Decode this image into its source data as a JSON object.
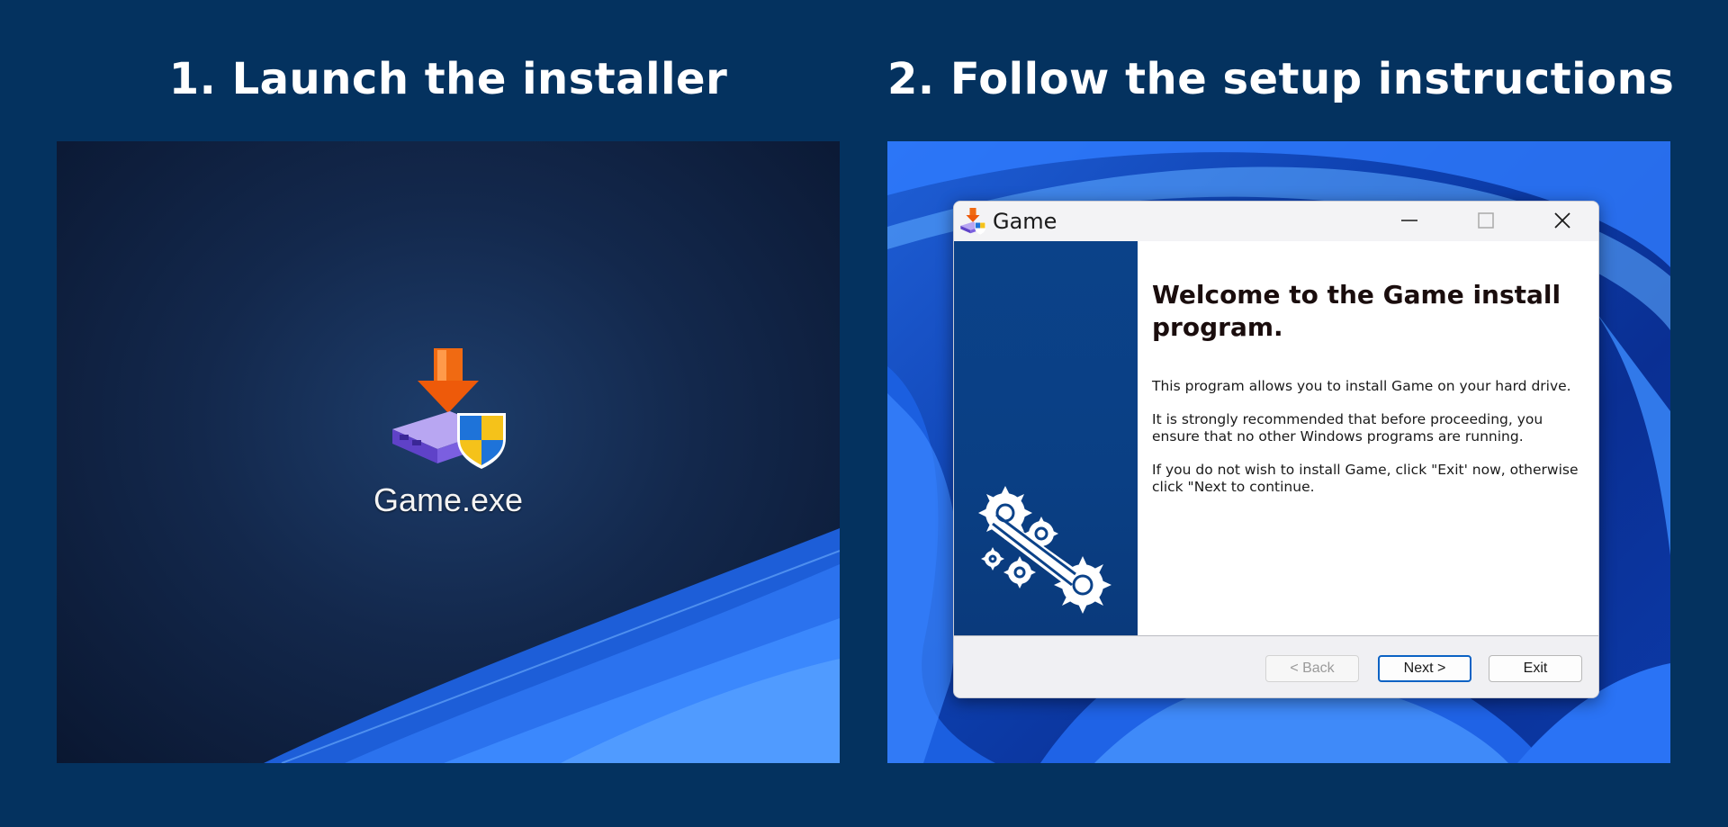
{
  "steps": [
    {
      "title": "1. Launch the installer"
    },
    {
      "title": "2. Follow the setup instructions"
    }
  ],
  "desktop": {
    "icon_name": "installer-icon",
    "icon_label": "Game.exe"
  },
  "installer": {
    "window_title": "Game",
    "app_icon": "installer-icon",
    "controls": {
      "minimize": "minimize-icon",
      "maximize": "maximize-icon",
      "close": "close-icon"
    },
    "banner_graphic": "gears-icon",
    "heading": "Welcome to the Game install program.",
    "paragraphs": [
      "This program allows you to install Game on your hard drive.",
      "It is strongly recommended that before proceeding, you ensure that no other Windows programs are running.",
      "If you do not wish to install Game, click \"Exit' now, otherwise click \"Next to continue."
    ],
    "buttons": {
      "back": "< Back",
      "next": "Next >",
      "exit": "Exit"
    }
  },
  "colors": {
    "background": "#04325f",
    "banner": "#0b4289",
    "accent": "#0b62c4"
  }
}
